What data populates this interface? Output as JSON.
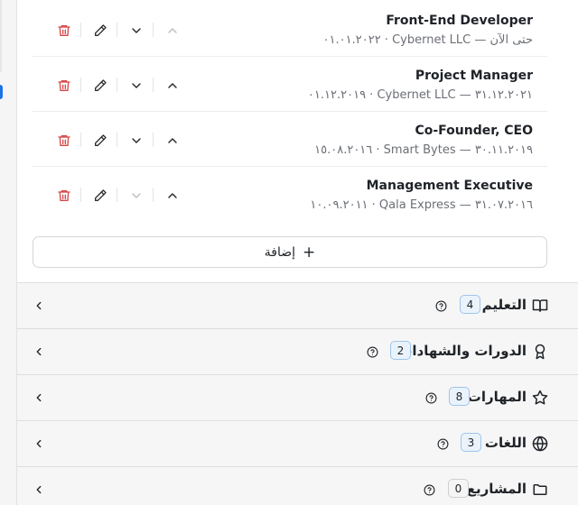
{
  "experience": {
    "entries": [
      {
        "title": "Front-End Developer",
        "subtitle": "٠١.٠١.٢٠٢٢ · Cybernet LLC — حتى الآن"
      },
      {
        "title": "Project Manager",
        "subtitle": "٠١.١٢.٢٠١٩ · Cybernet LLC — ٣١.١٢.٢٠٢١"
      },
      {
        "title": "Co-Founder, CEO",
        "subtitle": "١٥.٠٨.٢٠١٦ · Smart Bytes — ٣٠.١١.٢٠١٩"
      },
      {
        "title": "Management Executive",
        "subtitle": "١٠.٠٩.٢٠١١ · Qala Express — ٣١.٠٧.٢٠١٦"
      }
    ],
    "add_label": "إضافة",
    "add_icon": "+"
  },
  "sections": [
    {
      "title": "التعليم",
      "count": "4",
      "icon": "book-icon"
    },
    {
      "title": "الدورات والشهادات",
      "count": "2",
      "icon": "award-icon"
    },
    {
      "title": "المهارات",
      "count": "8",
      "icon": "star-icon"
    },
    {
      "title": "اللغات",
      "count": "3",
      "icon": "globe-icon"
    },
    {
      "title": "المشاريع",
      "count": "0",
      "icon": "folder-icon"
    }
  ],
  "colors": {
    "delete_icon": "#d64545",
    "count_badge_border": "#9ec5ea",
    "count_badge_bg": "#eaf3fc",
    "edge_accent": "#1a73e8"
  }
}
